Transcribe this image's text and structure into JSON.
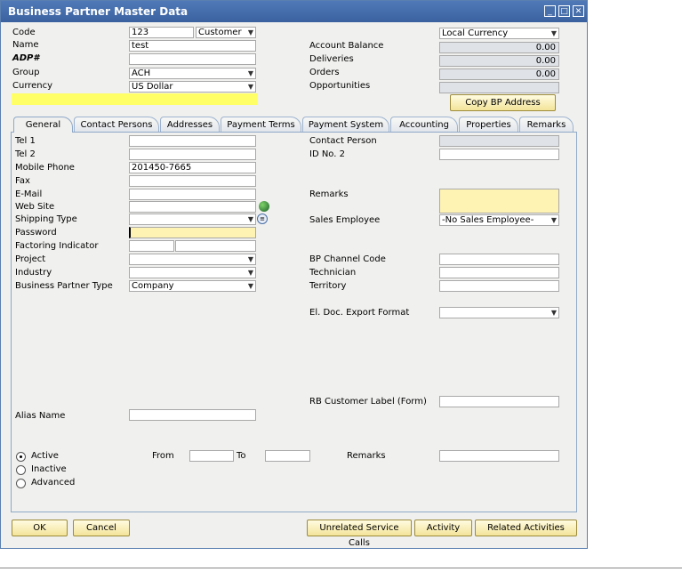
{
  "window": {
    "title": "Business Partner Master Data"
  },
  "header": {
    "code_label": "Code",
    "code_value": "123",
    "bp_kind": "Customer",
    "name_label": "Name",
    "name_value": "test",
    "adp_label": "ADP#",
    "adp_value": "",
    "group_label": "Group",
    "group_value": "ACH",
    "currency_label": "Currency",
    "currency_value": "US Dollar",
    "currency_mode": "Local Currency",
    "account_balance_label": "Account Balance",
    "account_balance_value": "0.00",
    "deliveries_label": "Deliveries",
    "deliveries_value": "0.00",
    "orders_label": "Orders",
    "orders_value": "0.00",
    "opportunities_label": "Opportunities",
    "opportunities_value": "",
    "copy_bp_label": "Copy BP Address"
  },
  "tabs": [
    "General",
    "Contact Persons",
    "Addresses",
    "Payment Terms",
    "Payment System",
    "Accounting",
    "Properties",
    "Remarks"
  ],
  "general": {
    "tel1_label": "Tel 1",
    "tel1": "",
    "tel2_label": "Tel 2",
    "tel2": "",
    "mobile_label": "Mobile Phone",
    "mobile": "201450-7665",
    "fax_label": "Fax",
    "fax": "",
    "email_label": "E-Mail",
    "email": "",
    "web_label": "Web Site",
    "web": "",
    "shipping_label": "Shipping Type",
    "shipping": "",
    "password_label": "Password",
    "password": "",
    "factoring_label": "Factoring Indicator",
    "project_label": "Project",
    "project": "",
    "industry_label": "Industry",
    "industry": "",
    "bptype_label": "Business Partner Type",
    "bptype": "Company",
    "contact_label": "Contact Person",
    "contact": "",
    "idno2_label": "ID No. 2",
    "idno2": "",
    "remarks_label": "Remarks",
    "remarks": "",
    "sales_emp_label": "Sales Employee",
    "sales_emp": "-No Sales Employee-",
    "bp_channel_label": "BP Channel Code",
    "bp_channel": "",
    "technician_label": "Technician",
    "technician": "",
    "territory_label": "Territory",
    "territory": "",
    "eldoc_label": "El. Doc. Export Format",
    "eldoc": "",
    "rb_label": "RB Customer Label (Form)",
    "rb": "",
    "alias_label": "Alias Name",
    "alias": "",
    "active_label": "Active",
    "inactive_label": "Inactive",
    "advanced_label": "Advanced",
    "from_label": "From",
    "to_label": "To",
    "remarks2_label": "Remarks"
  },
  "buttons": {
    "ok": "OK",
    "cancel": "Cancel",
    "unrelated": "Unrelated Service Calls",
    "activity": "Activity",
    "related": "Related Activities"
  },
  "colors": {
    "titlebar": "#3b629f",
    "button_fill": "#f3e49a",
    "highlight": "#ffff66"
  }
}
